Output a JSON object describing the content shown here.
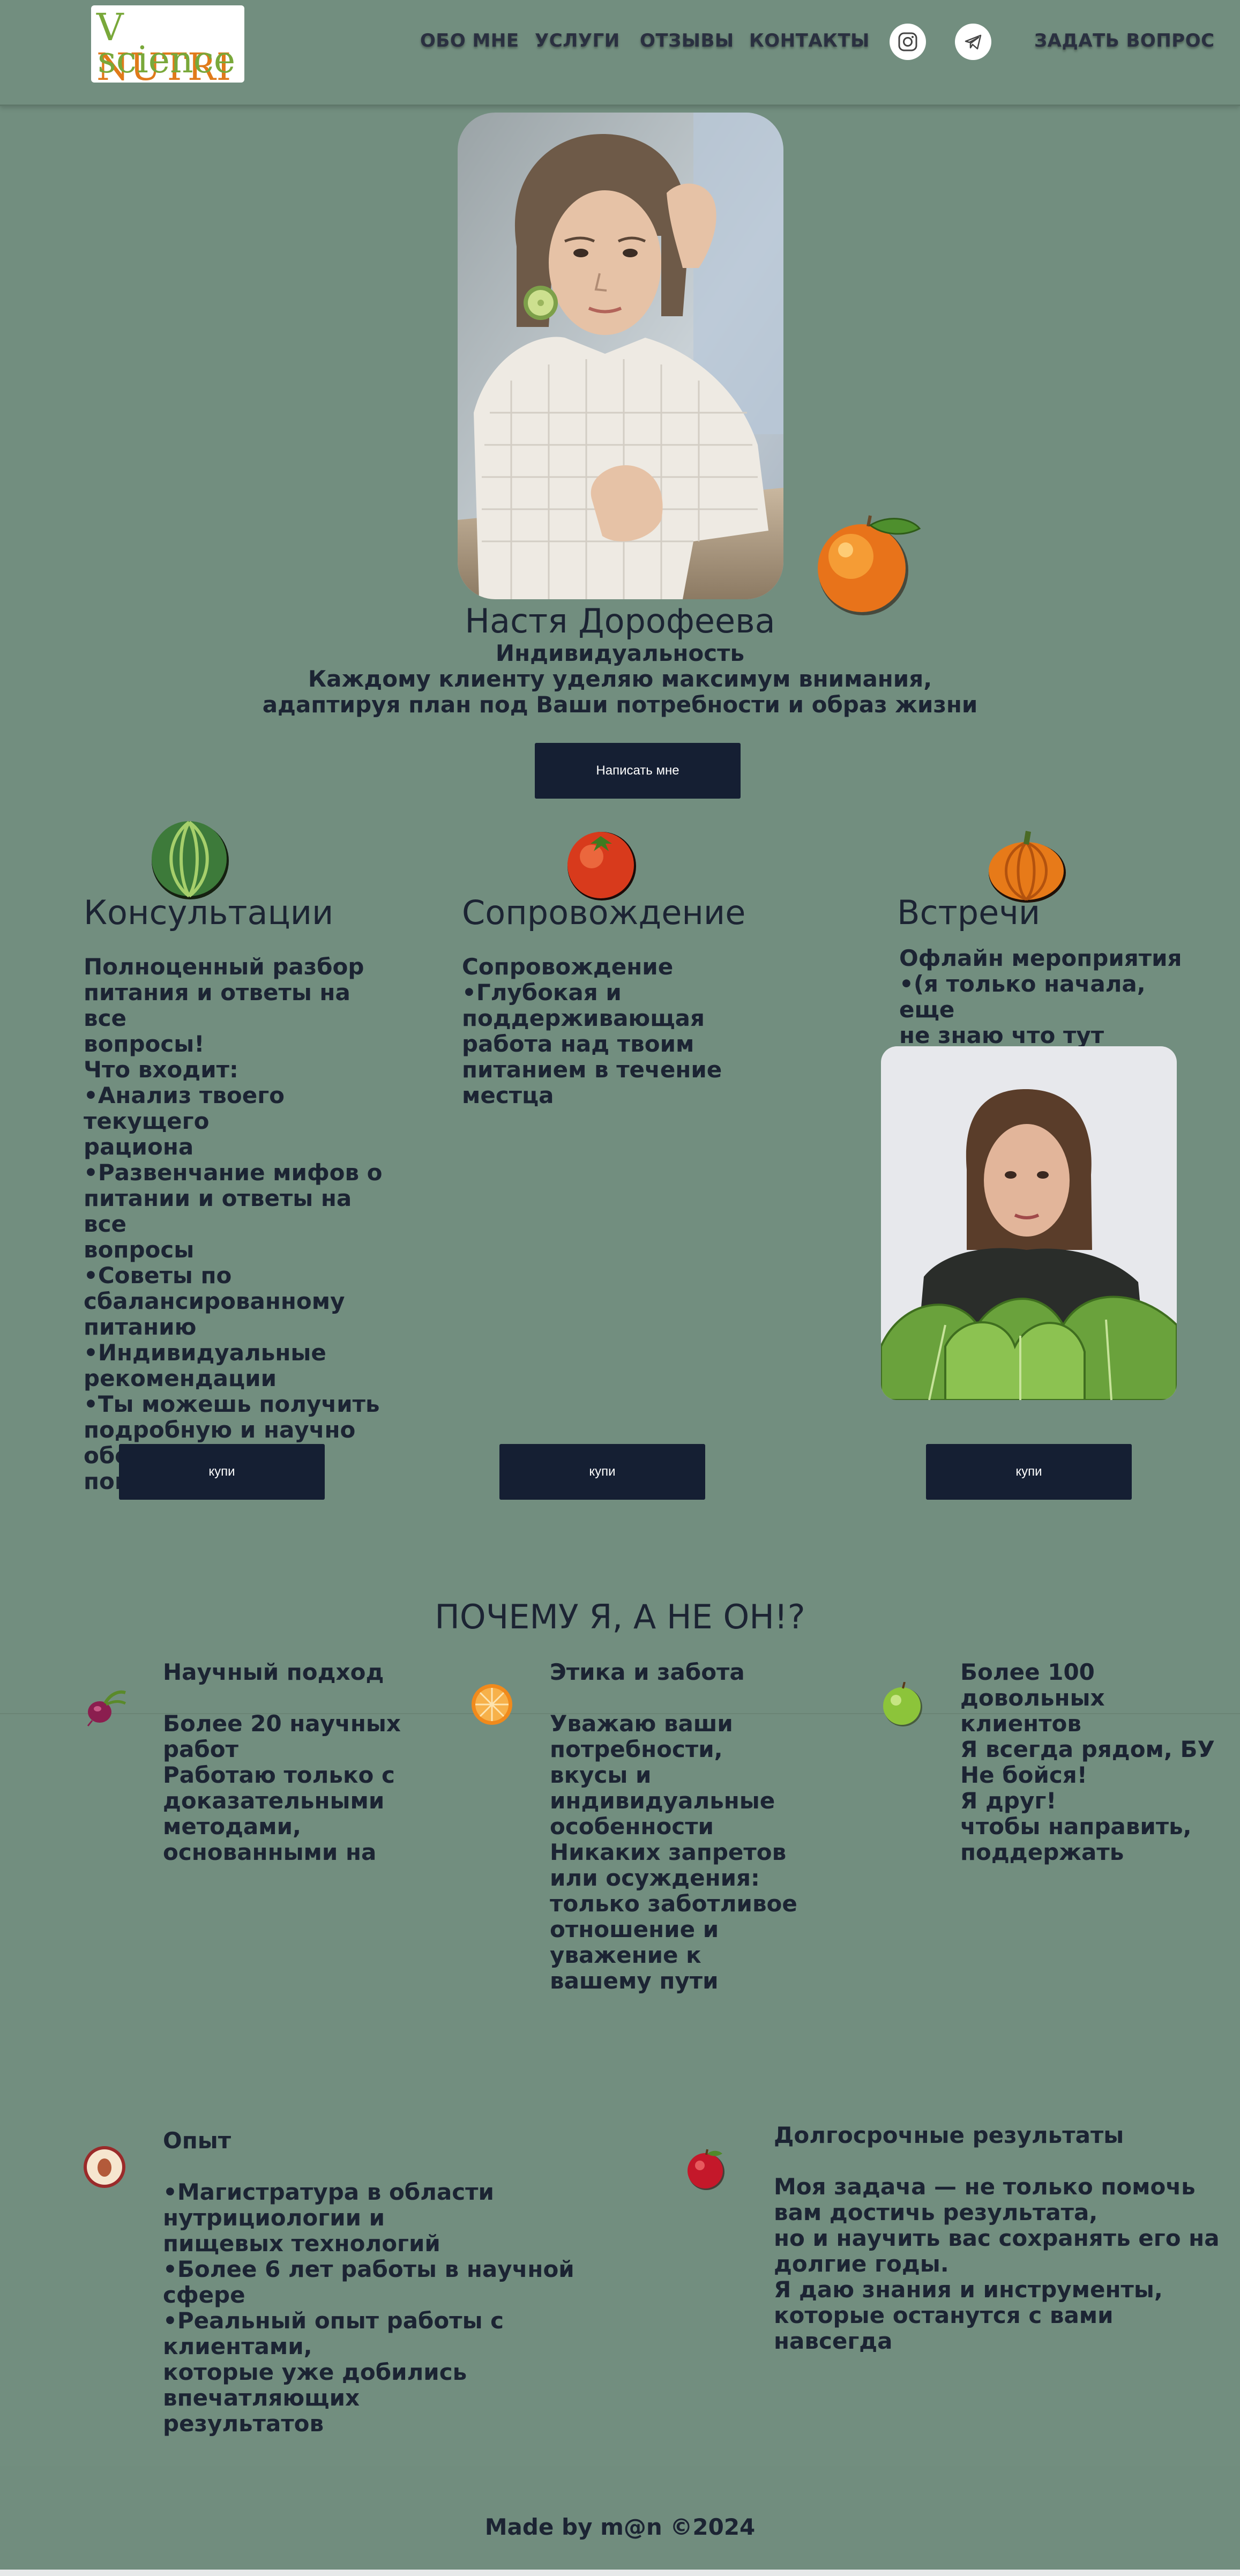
{
  "header": {
    "logo_line1_a": "V",
    "logo_line1_b": " NUTRI",
    "logo_line2": "science",
    "nav": [
      "ОБО МНЕ",
      "УСЛУГИ",
      "ОТЗЫВЫ",
      "КОНТАКТЫ"
    ],
    "ask_label": "ЗАДАТЬ ВОПРОС",
    "social_icons": [
      "instagram-icon",
      "telegram-icon"
    ]
  },
  "hero": {
    "name": "Настя Дорофеева",
    "tagline": "Индивидуальность",
    "line1": "Каждому клиенту уделяю максимум внимания,",
    "line2": "адаптируя план под Ваши потребности и образ жизни",
    "button": "Написать мне"
  },
  "services": [
    {
      "title": "Консультации",
      "text": "Полноценный разбор\nпитания и ответы на все\nвопросы!\nЧто входит:\n•Анализ твоего текущего\nрациона\n•Развенчание мифов о\nпитании и ответы на все\nвопросы\n•Советы по\nсбалансированному\nпитанию\n•Индивидуальные\nрекомендации\n•Ты можешь получить\nподробную и научно\nобоснованную помощь!",
      "button": "купи"
    },
    {
      "title": "Сопровождение",
      "text": "Сопровождение\n•Глубокая и\nподдерживающая\nработа над твоим\nпитанием в течение\nместца",
      "button": "купи"
    },
    {
      "title": "Встречи",
      "text": "Офлайн мероприятия\n•(я только начала, еще\nне знаю что тут писать)",
      "button": "купи"
    }
  ],
  "why": {
    "title": "ПОЧЕМУ Я, А НЕ ОН!?",
    "items": [
      {
        "heading": "Научный подход",
        "text": "Более 20 научных\nработ\nРаботаю только с\nдоказательными\nметодами,\nоснованными на"
      },
      {
        "heading": "Этика и забота",
        "text": "Уважаю ваши\nпотребности,\nвкусы и\nиндивидуальные\nособенности\nНикаких запретов\nили осуждения:\nтолько заботливое\nотношение и\nуважение к\nвашему пути"
      },
      {
        "heading": "Более 100\nдовольных клиентов",
        "text": "Я всегда рядом, БУ\nНе бойся!\nЯ друг!\nчтобы направить,\nподдержать"
      },
      {
        "heading": "Опыт",
        "text": "•Магистратура в области нутрициологии и\nпищевых технологий\n•Более 6 лет работы в научной сфере\n•Реальный опыт работы с клиентами,\nкоторые уже добились впечатляющих\nрезультатов"
      },
      {
        "heading": "Долгосрочные результаты",
        "text": "Моя задача — не только помочь\nвам достичь результата,\nно и научить вас сохранять его на\nдолгие годы.\nЯ даю знания и инструменты,\nкоторые останутся с вами навсегда"
      }
    ]
  },
  "footer": {
    "text": "Made by m@n ©2024"
  },
  "colors": {
    "background": "#728e7f",
    "button": "#151f33",
    "text": "#1c2433"
  }
}
